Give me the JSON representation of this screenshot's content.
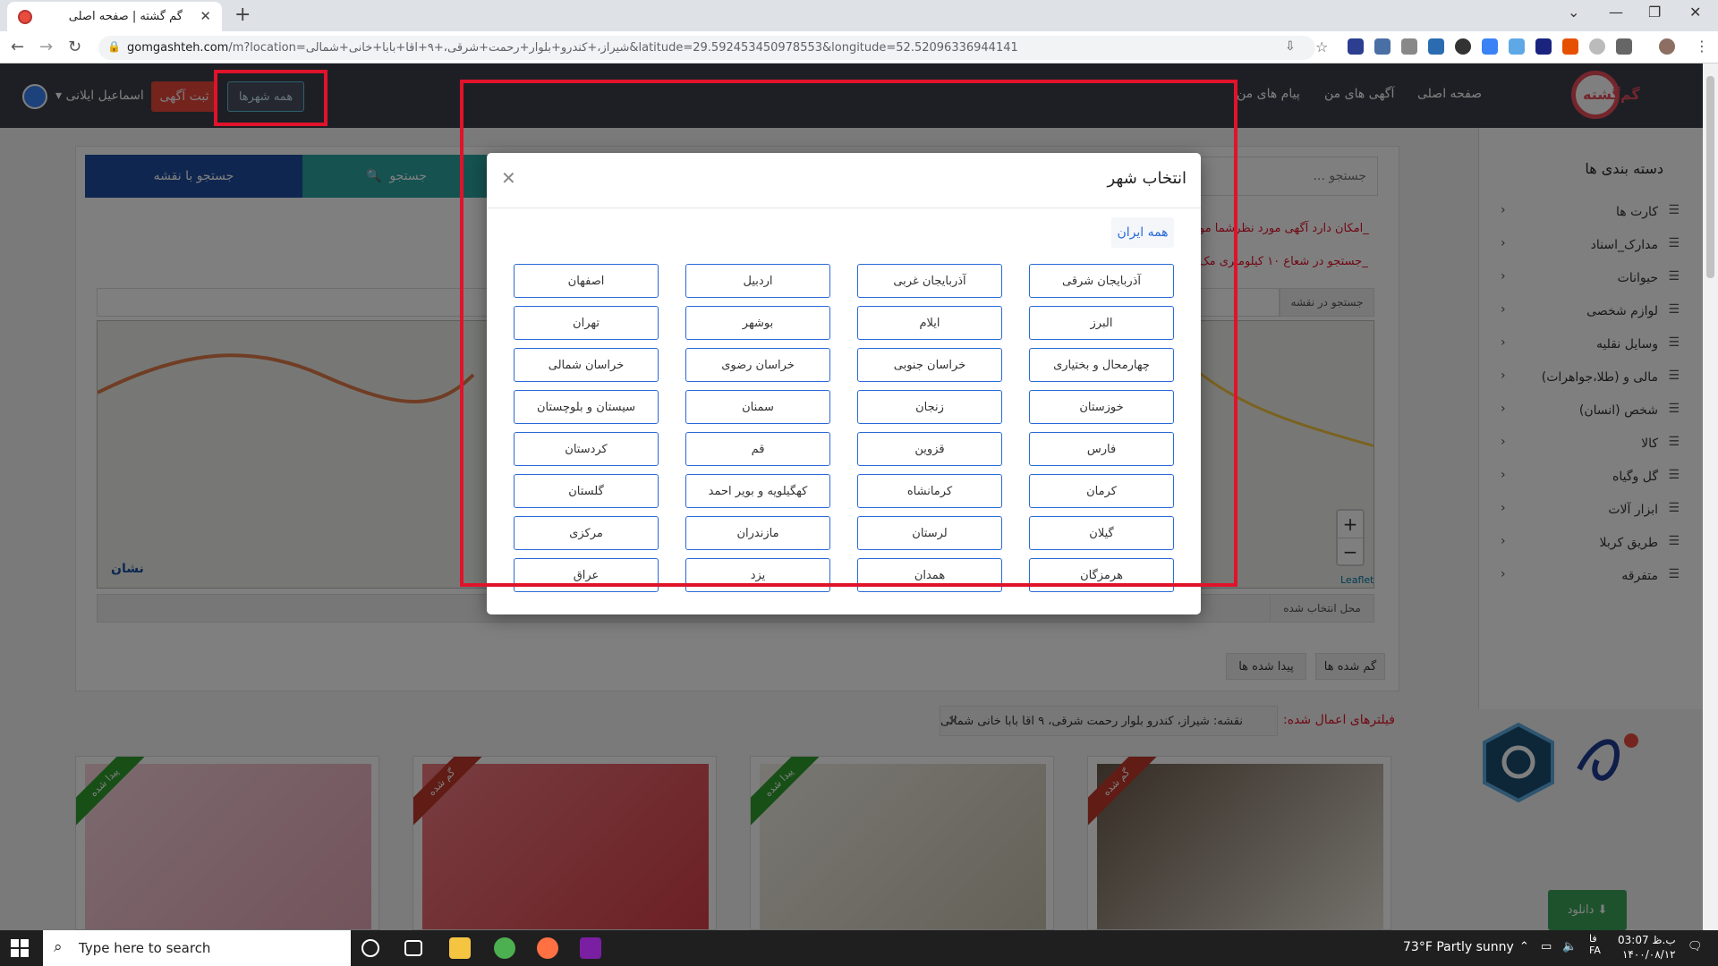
{
  "browser": {
    "tab_title": "گم گشته | صفحه اصلی",
    "url_host": "gomgashteh.com",
    "url_path": "/m?location=شیراز،+کندرو+بلوار+رحمت+شرقی،+۹+اقا+بابا+خانی+شمالی&latitude=29.592453450978553&longitude=52.52096336944141"
  },
  "header": {
    "logo_text": "گم‌گشته",
    "nav": [
      "صفحه اصلی",
      "آگهی های من",
      "پیام های من"
    ],
    "all_cities_label": "همه شهرها",
    "post_ad_label": "ثبت آگهی",
    "user_name": "اسماعیل ایلانی"
  },
  "search": {
    "tab_search": "جستجو",
    "tab_map_search": "جستجو با نقشه",
    "placeholder": "جستجو ...",
    "info_line_1": "_امکان دارد آگهی مورد نظرشما مو",
    "info_line_2": "_جستجو در شعاع ۱۰ کیلومتری مک",
    "map_search_label": "جستجو در نقشه",
    "selected_place_label": "محل انتخاب شده",
    "map_attribution": "Leaflet",
    "map_brand": "نشان"
  },
  "results": {
    "lost_tab": "گم شده ها",
    "found_tab": "پیدا شده ها",
    "filters_title": "فیلترهای اعمال شده:",
    "filter_chip": "نقشه: شیراز، کندرو بلوار رحمت شرقی، ۹ اقا بابا خانی شمالی",
    "found_ribbon": "پیدا شده",
    "lost_ribbon": "گم شده"
  },
  "sidebar": {
    "title": "دسته بندی ها",
    "categories": [
      "کارت ها",
      "مدارک_اسناد",
      "حیوانات",
      "لوازم شخصی",
      "وسایل نقلیه",
      "مالی و (طلا،جواهرات)",
      "شخص (انسان)",
      "کالا",
      "گل وگیاه",
      "ابزار آلات",
      "طریق کربلا",
      "متفرقه"
    ],
    "download_label": "دانلود"
  },
  "modal": {
    "title": "انتخاب شهر",
    "all_iran": "همه ایران",
    "cities": [
      [
        "آذربایجان شرقی",
        "آذربایجان غربی",
        "اردبیل",
        "اصفهان"
      ],
      [
        "البرز",
        "ایلام",
        "بوشهر",
        "تهران"
      ],
      [
        "چهارمحال و بختیاری",
        "خراسان جنوبی",
        "خراسان رضوی",
        "خراسان شمالی"
      ],
      [
        "خوزستان",
        "زنجان",
        "سمنان",
        "سیستان و بلوچستان"
      ],
      [
        "فارس",
        "قزوین",
        "قم",
        "کردستان"
      ],
      [
        "کرمان",
        "کرمانشاه",
        "کهگیلویه و بویر احمد",
        "گلستان"
      ],
      [
        "گیلان",
        "لرستان",
        "مازندران",
        "مرکزی"
      ],
      [
        "هرمزگان",
        "همدان",
        "یزد",
        "عراق"
      ]
    ]
  },
  "taskbar": {
    "search_placeholder": "Type here to search",
    "weather": "73°F  Partly sunny",
    "lang": "FA",
    "lang_fa": "فا",
    "time": "03:07 ب.ظ",
    "date": "۱۴۰۰/۰۸/۱۲"
  },
  "colors": {
    "accent_blue": "#2a6ad8",
    "header_bg": "#3a3f4a",
    "highlight_red": "#e0132b",
    "post_btn": "#e8463a"
  }
}
